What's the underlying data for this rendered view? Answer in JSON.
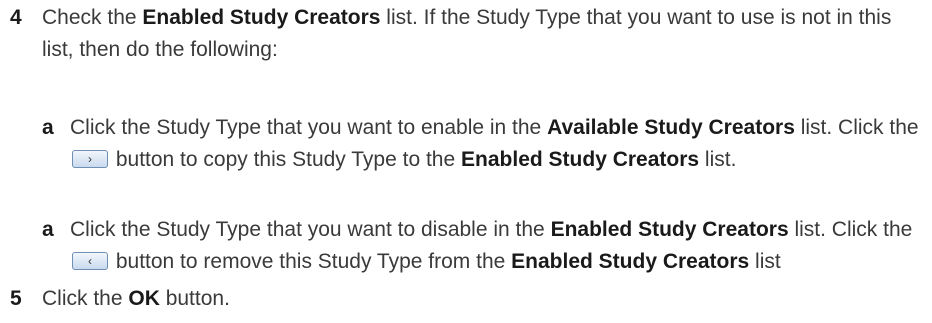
{
  "step4": {
    "number": "4",
    "t1": "Check the ",
    "b1": "Enabled Study Creators",
    "t2": " list. If the Study Type that you want to use is not in this list, then do the following:"
  },
  "sub1": {
    "letter": "a",
    "t1": "Click the Study Type that you want to enable in the ",
    "b1": "Available Study Creators",
    "t2": " list. Click the ",
    "button_glyph": "›",
    "t3": " button to copy this Study Type to the ",
    "b2": "Enabled Study Creators",
    "t4": " list."
  },
  "sub2": {
    "letter": "a",
    "t1": "Click the Study Type that you want to disable in the ",
    "b1": "Enabled Study Creators",
    "t2": " list. Click the ",
    "button_glyph": "‹",
    "t3": " button to remove this Study Type from the ",
    "b2": "Enabled Study Creators",
    "t4": " list"
  },
  "step5": {
    "number": "5",
    "t1": "Click the ",
    "b1": "OK",
    "t2": " button."
  }
}
